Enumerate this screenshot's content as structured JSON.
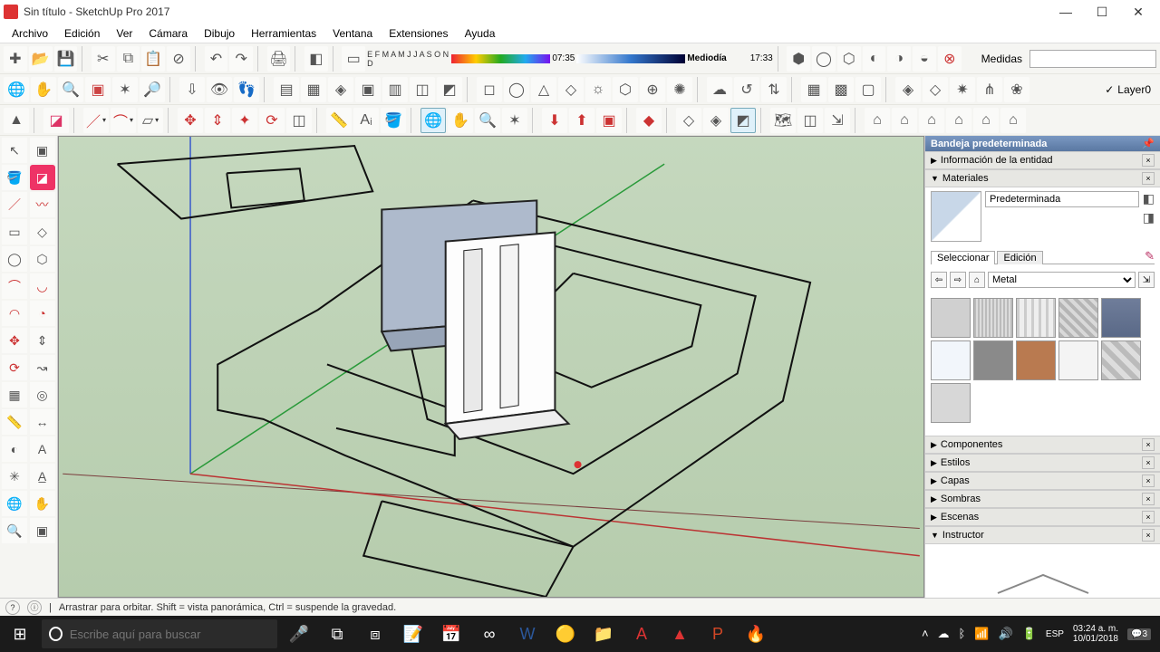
{
  "window": {
    "title": "Sin título - SketchUp Pro 2017",
    "minimize": "—",
    "maximize": "☐",
    "close": "✕"
  },
  "menu": {
    "archivo": "Archivo",
    "edicion": "Edición",
    "ver": "Ver",
    "camara": "Cámara",
    "dibujo": "Dibujo",
    "herramientas": "Herramientas",
    "ventana": "Ventana",
    "extensiones": "Extensiones",
    "ayuda": "Ayuda"
  },
  "shadows": {
    "months": "E F M A M J J A S O N D",
    "time_start": "07:35",
    "noon": "Mediodía",
    "time_end": "17:33"
  },
  "measurements": {
    "label": "Medidas",
    "value": ""
  },
  "layers": {
    "current": "Layer0"
  },
  "tray": {
    "title": "Bandeja predeterminada",
    "entity_info": "Información de la entidad",
    "materials": "Materiales",
    "components": "Componentes",
    "styles": "Estilos",
    "layers": "Capas",
    "shadows": "Sombras",
    "scenes": "Escenas",
    "instructor": "Instructor"
  },
  "materials": {
    "name": "Predeterminada",
    "tab_select": "Seleccionar",
    "tab_edit": "Edición",
    "category": "Metal",
    "swatches": [
      "#d0d0d0",
      "repeating-linear-gradient(90deg,#bbb 0 2px,#ddd 2px 4px)",
      "repeating-linear-gradient(90deg,#ccc 0 3px,#eee 3px 8px)",
      "repeating-linear-gradient(45deg,#b5b5b5 0 4px,#d9d9d9 4px 8px)",
      "linear-gradient(#6f7d9a,#5a6987)",
      "#f2f6fb",
      "#8a8a8a",
      "#b97a50",
      "#f4f4f4",
      "repeating-linear-gradient(45deg,#bbb 0 6px,#ddd 6px 12px)",
      "#d7d7d7"
    ]
  },
  "status": {
    "hint": "Arrastrar para orbitar. Shift = vista panorámica, Ctrl = suspende la gravedad."
  },
  "taskbar": {
    "search_placeholder": "Escribe aquí para buscar",
    "lang": "ESP",
    "time": "03:24 a. m.",
    "date": "10/01/2018",
    "notif": "3"
  }
}
